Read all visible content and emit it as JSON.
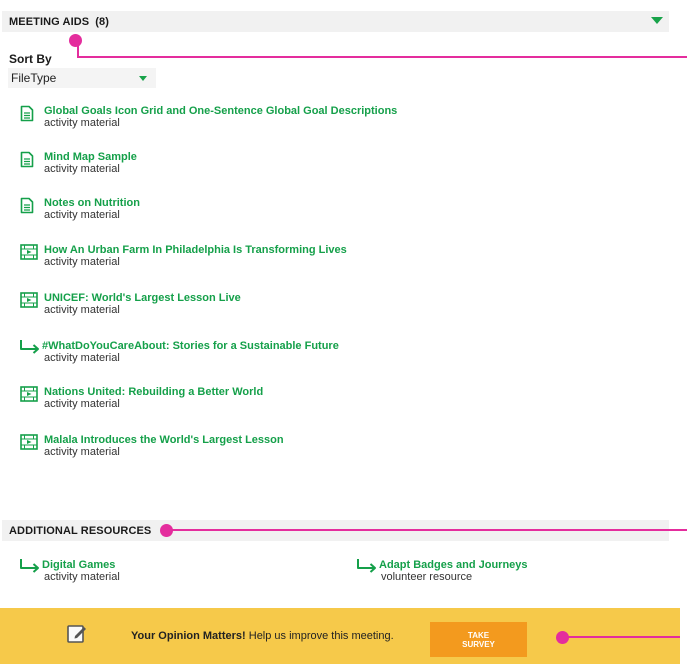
{
  "meeting_aids": {
    "title": "MEETING AIDS",
    "count": "(8)"
  },
  "sort": {
    "label": "Sort By",
    "selected": "FileType"
  },
  "items": [
    {
      "title": "Global Goals Icon Grid and One-Sentence Global Goal Descriptions",
      "sub": "activity material",
      "icon": "document-icon"
    },
    {
      "title": "Mind Map Sample",
      "sub": "activity material",
      "icon": "document-icon"
    },
    {
      "title": "Notes on Nutrition",
      "sub": "activity material",
      "icon": "document-icon"
    },
    {
      "title": "How An Urban Farm In Philadelphia Is Transforming Lives",
      "sub": "activity material",
      "icon": "video-icon"
    },
    {
      "title": "UNICEF: World's Largest Lesson Live",
      "sub": "activity material",
      "icon": "video-icon"
    },
    {
      "title": "#WhatDoYouCareAbout: Stories for a Sustainable Future",
      "sub": "activity material",
      "icon": "link-arrow-icon"
    },
    {
      "title": "Nations United: Rebuilding a Better World",
      "sub": "activity material",
      "icon": "video-icon"
    },
    {
      "title": "Malala Introduces the World's Largest Lesson",
      "sub": "activity material",
      "icon": "video-icon"
    }
  ],
  "additional_resources": {
    "title": "ADDITIONAL RESOURCES",
    "items": [
      {
        "title": "Digital Games",
        "sub": "activity material",
        "icon": "link-arrow-icon"
      },
      {
        "title": "Adapt Badges and Journeys",
        "sub": "volunteer resource",
        "icon": "link-arrow-icon"
      }
    ]
  },
  "survey": {
    "bold": "Your Opinion Matters!",
    "text": " Help us improve this meeting.",
    "button": "TAKE\nSURVEY",
    "icon": "edit-note-icon"
  },
  "colors": {
    "accent_green": "#15a04a",
    "annotation_pink": "#e42d9d",
    "survey_bg": "#f6c94a",
    "survey_button": "#f39a1e"
  }
}
